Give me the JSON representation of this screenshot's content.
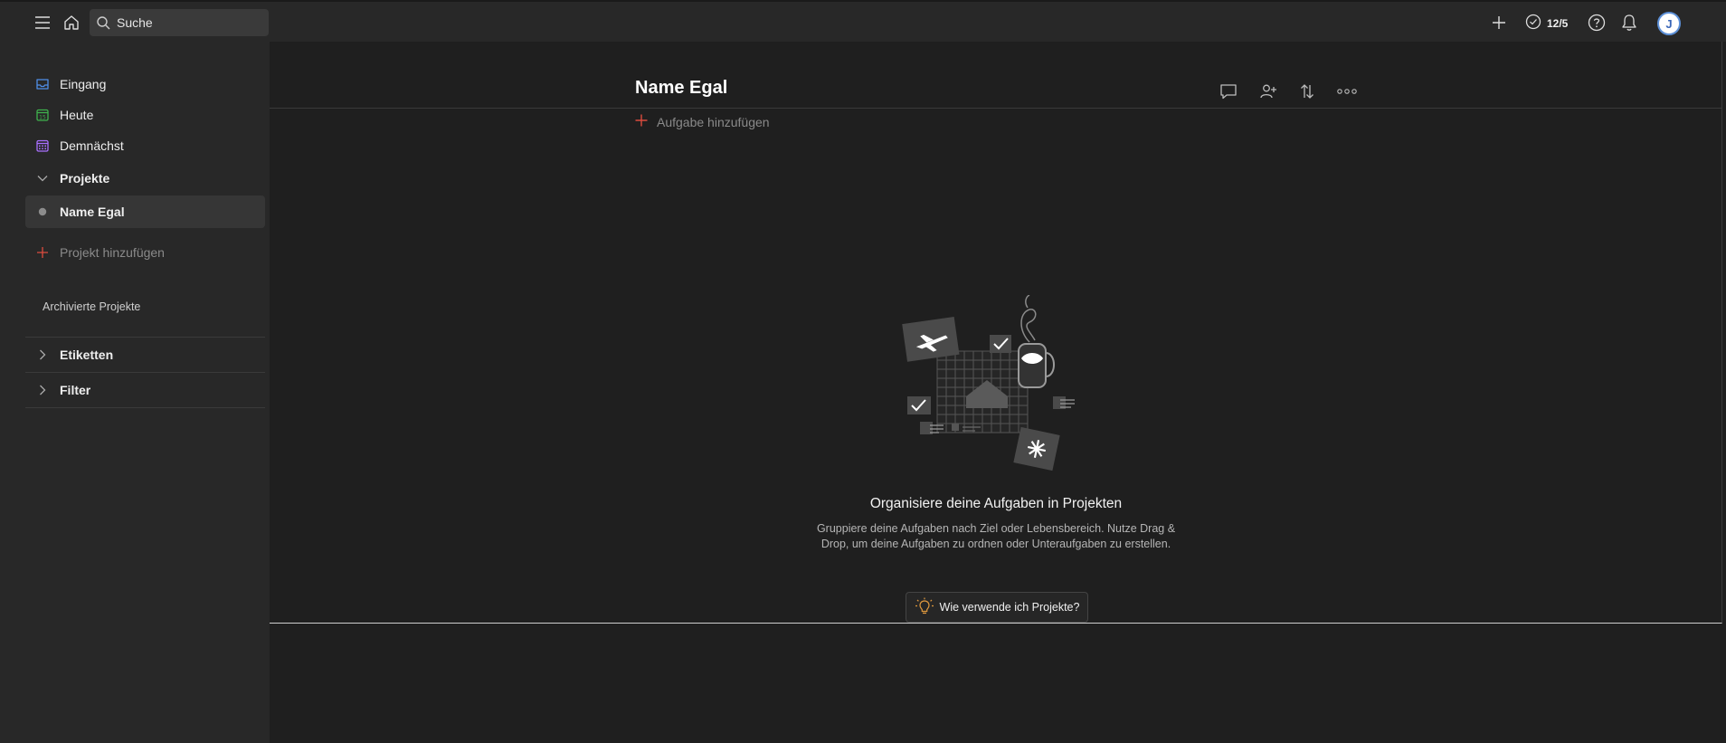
{
  "topbar": {
    "search_placeholder": "Suche",
    "karma_count": "12/5",
    "avatar_initial": "J"
  },
  "sidebar": {
    "inbox": "Eingang",
    "today": "Heute",
    "upcoming": "Demnächst",
    "projects_header": "Projekte",
    "project_item": "Name Egal",
    "add_project": "Projekt hinzufügen",
    "archived": "Archivierte Projekte",
    "labels": "Etiketten",
    "filters": "Filter"
  },
  "main": {
    "project_title": "Name Egal",
    "add_task": "Aufgabe hinzufügen",
    "empty_title": "Organisiere deine Aufgaben in Projekten",
    "empty_desc": "Gruppiere deine Aufgaben nach Ziel oder Lebensbereich. Nutze Drag & Drop, um deine Aufgaben zu ordnen oder Unteraufgaben zu erstellen.",
    "help_button": "Wie verwende ich Projekte?"
  },
  "colors": {
    "accent_red": "#dc4c3e",
    "inbox_blue": "#4f8ee8",
    "today_green": "#3fb24d",
    "upcoming_purple": "#a970ff",
    "bulb_orange": "#e0993e"
  }
}
